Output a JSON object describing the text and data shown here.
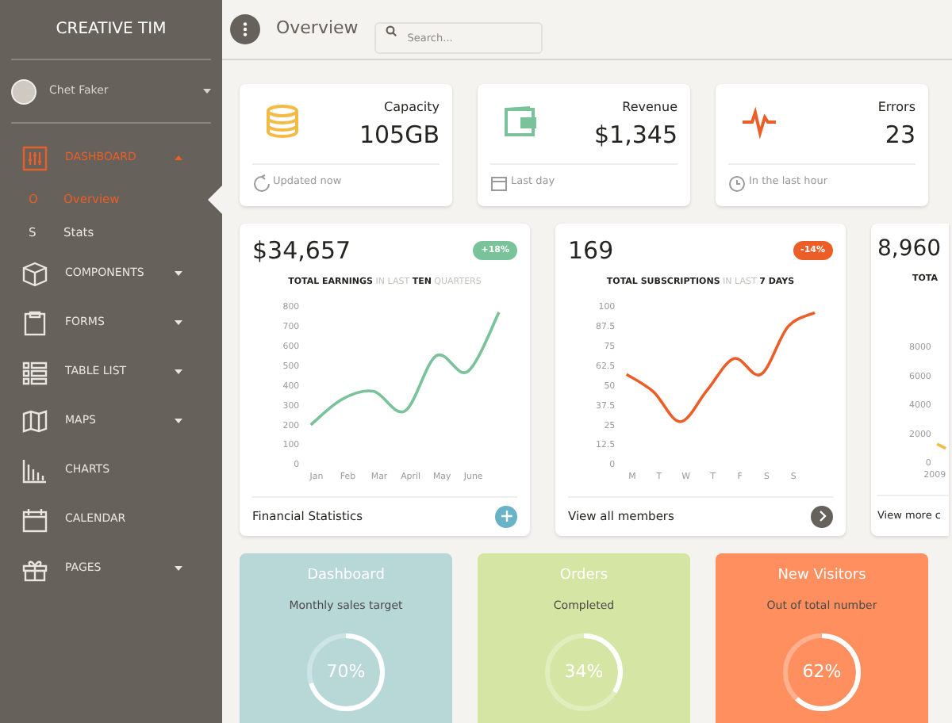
{
  "sidebar": {
    "brand": "CREATIVE TIM",
    "user": {
      "name": "Chet Faker"
    },
    "items": [
      {
        "label": "DASHBOARD",
        "kind": "group",
        "expanded": true,
        "selected": true,
        "children": [
          {
            "abbr": "O",
            "label": "Overview",
            "selected": true
          },
          {
            "abbr": "S",
            "label": "Stats",
            "selected": false
          }
        ]
      },
      {
        "label": "COMPONENTS",
        "kind": "group",
        "expanded": false,
        "selected": false
      },
      {
        "label": "FORMS",
        "kind": "group",
        "expanded": false,
        "selected": false
      },
      {
        "label": "TABLE LIST",
        "kind": "group",
        "expanded": false,
        "selected": false
      },
      {
        "label": "MAPS",
        "kind": "group",
        "expanded": false,
        "selected": false
      },
      {
        "label": "CHARTS",
        "kind": "link",
        "selected": false
      },
      {
        "label": "CALENDAR",
        "kind": "link",
        "selected": false
      },
      {
        "label": "PAGES",
        "kind": "group",
        "expanded": false,
        "selected": false
      }
    ]
  },
  "header": {
    "title": "Overview",
    "search": {
      "placeholder": "Search..."
    }
  },
  "stats": [
    {
      "title": "Capacity",
      "value": "105GB",
      "color": "#f3bb45",
      "footer": "Updated now"
    },
    {
      "title": "Revenue",
      "value": "$1,345",
      "color": "#7ac29a",
      "footer": "Last day"
    },
    {
      "title": "Errors",
      "value": "23",
      "color": "#eb5e28",
      "footer": "In the last hour"
    }
  ],
  "chart_cards": [
    {
      "kind": "add",
      "value": "$34,657",
      "badge": {
        "text": "+18%",
        "color": "#7ac29a"
      },
      "subtitle": "**TOTAL EARNINGS** IN LAST **TEN** QUARTERS",
      "footer": "Financial Statistics",
      "chart_data": {
        "type": "line",
        "categories": [
          "Jan",
          "Feb",
          "Mar",
          "April",
          "May",
          "June",
          null
        ],
        "series": [
          {
            "color": "#7ac29a",
            "values": [
              200,
              330,
              370,
              270,
              550,
              470,
              770
            ]
          }
        ],
        "ylim": [
          0,
          800
        ],
        "yticks": [
          0,
          100,
          200,
          300,
          400,
          500,
          600,
          700,
          800
        ]
      }
    },
    {
      "kind": "next",
      "value": "169",
      "badge": {
        "text": "-14%",
        "color": "#eb5e28"
      },
      "subtitle": "**TOTAL SUBSCRIPTIONS** IN LAST **7 DAYS**",
      "footer": "View all members",
      "chart_data": {
        "type": "line",
        "categories": [
          "M",
          "T",
          "W",
          "T",
          "F",
          "S",
          "S",
          null
        ],
        "series": [
          {
            "color": "#eb5e28",
            "values": [
              57,
              46,
              27,
              47,
              67,
              57,
              87,
              96
            ]
          }
        ],
        "ylim": [
          0,
          100
        ],
        "yticks": [
          0,
          {
            "value": 12.5,
            "label": "12.5"
          },
          25,
          {
            "value": 37.5,
            "label": "37.5"
          },
          50,
          {
            "value": 62.5,
            "label": "62.5"
          },
          75,
          {
            "value": 87.5,
            "label": "87.5"
          },
          100
        ]
      }
    },
    {
      "kind": "partial",
      "value": "8,960",
      "subtitle": "**TOTA**",
      "footer": "View more c",
      "y_axis_labels": [
        "8000",
        "6000",
        "4000",
        "2000",
        "0"
      ],
      "x_axis_labels": [
        "2009"
      ]
    }
  ],
  "progress_cards": [
    {
      "title": "Dashboard",
      "subtitle": "Monthly sales target",
      "level": 0.7,
      "value": "70%",
      "color": "#b8d8d8"
    },
    {
      "title": "Orders",
      "subtitle": "Completed",
      "level": 0.34,
      "value": "34%",
      "color": "#d5e5a3"
    },
    {
      "title": "New Visitors",
      "subtitle": "Out of total number",
      "level": 0.62,
      "value": "62%",
      "color": "#ff8f5e"
    }
  ]
}
